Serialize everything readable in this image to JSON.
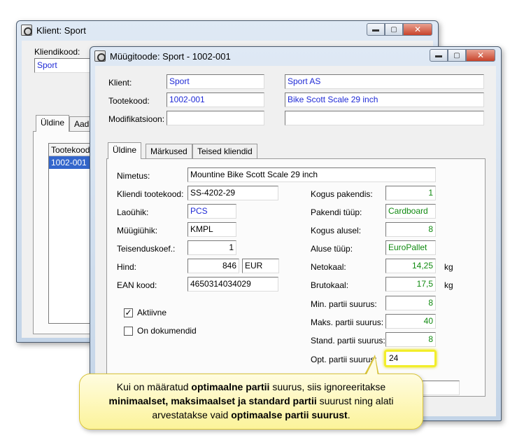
{
  "back_window": {
    "title": "Klient: Sport",
    "kliendikood_label": "Kliendikood:",
    "kliendikood_value": "Sport",
    "tabs": [
      "Üldine",
      "Aad"
    ],
    "list_header": "Tootekood",
    "list_rows": [
      "1002-001"
    ]
  },
  "front_window": {
    "title": "Müügitoode: Sport - 1002-001",
    "header": {
      "klient_label": "Klient:",
      "klient_code": "Sport",
      "klient_name": "Sport AS",
      "tootekood_label": "Tootekood:",
      "tootekood_code": "1002-001",
      "tootekood_name": "Bike Scott Scale 29 inch",
      "modifikatsioon_label": "Modifikatsioon:",
      "modifikatsioon_code": "",
      "modifikatsioon_name": ""
    },
    "tabs": [
      "Üldine",
      "Märkused",
      "Teised kliendid"
    ],
    "general": {
      "nimetus_label": "Nimetus:",
      "nimetus_value": "Mountine Bike Scott Scale 29 inch",
      "kliendi_tootekood_label": "Kliendi tootekood:",
      "kliendi_tootekood_value": "SS-4202-29",
      "laouhik_label": "Laoühik:",
      "laouhik_value": "PCS",
      "muugiuhik_label": "Müügiühik:",
      "muugiuhik_value": "KMPL",
      "teisenduskoef_label": "Teisenduskoef.:",
      "teisenduskoef_value": "1",
      "hind_label": "Hind:",
      "hind_value": "846",
      "hind_currency": "EUR",
      "ean_label": "EAN kood:",
      "ean_value": "4650314034029",
      "aktiivne_label": "Aktiivne",
      "aktiivne_checked": true,
      "dokumendid_label": "On dokumendid",
      "dokumendid_checked": false
    },
    "packaging": {
      "kogus_pakendis_label": "Kogus pakendis:",
      "kogus_pakendis_value": "1",
      "pakendi_tuup_label": "Pakendi tüüp:",
      "pakendi_tuup_value": "Cardboard",
      "kogus_alusel_label": "Kogus alusel:",
      "kogus_alusel_value": "8",
      "aluse_tuup_label": "Aluse tüüp:",
      "aluse_tuup_value": "EuroPallet",
      "netokaal_label": "Netokaal:",
      "netokaal_value": "14,25",
      "netokaal_unit": "kg",
      "brutokaal_label": "Brutokaal:",
      "brutokaal_value": "17,5",
      "brutokaal_unit": "kg",
      "min_partii_label": "Min. partii suurus:",
      "min_partii_value": "8",
      "maks_partii_label": "Maks. partii suurus:",
      "maks_partii_value": "40",
      "stand_partii_label": "Stand. partii suurus:",
      "stand_partii_value": "8",
      "opt_partii_label": "Opt. partii suurus:",
      "opt_partii_value": "24"
    }
  },
  "callout": {
    "t1": "Kui on määratud ",
    "b1": "optimaalne partii",
    "t2": " suurus, siis ignoreeritakse",
    "b2": "minimaalset, maksimaalset ja standard partii",
    "t3": " suurust ning alati",
    "t4": "arvestatakse vaid ",
    "b3": "optimaalse partii suurust",
    "t5": "."
  },
  "colors": {
    "link_blue": "#1f2ad6",
    "value_green": "#108a10",
    "highlight_yellow": "#f2ee2a",
    "callout_bg": "#fcf39a"
  }
}
